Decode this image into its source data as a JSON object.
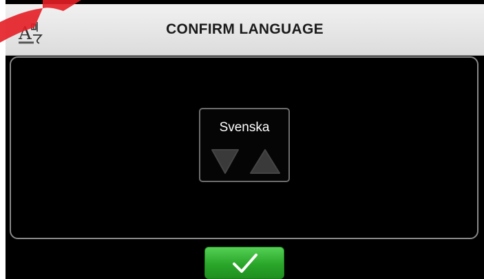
{
  "header": {
    "title": "CONFIRM LANGUAGE",
    "icon": "language-icon"
  },
  "selector": {
    "selected_language": "Svenska",
    "down_icon": "triangle-down-icon",
    "up_icon": "triangle-up-icon"
  },
  "confirm": {
    "icon": "checkmark-icon"
  },
  "colors": {
    "header_bg": "#e4e4e4",
    "screen_bg": "#000000",
    "confirm_green": "#2aa62a",
    "arrow_gray": "#3a3a3a"
  }
}
